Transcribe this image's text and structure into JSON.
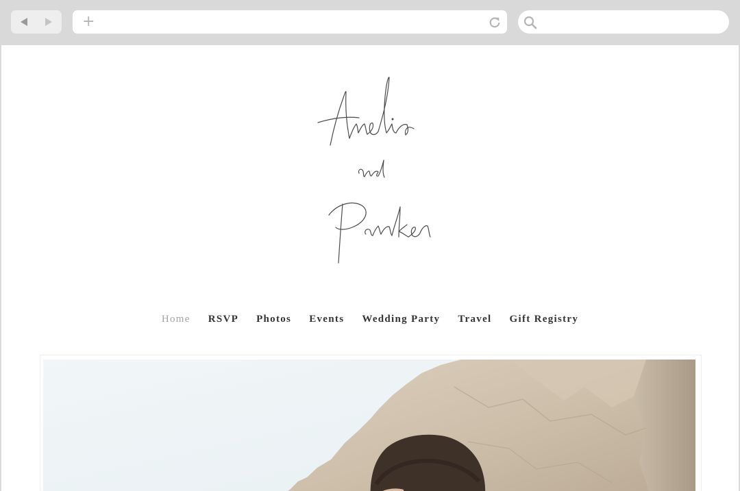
{
  "browser": {
    "back_icon": "back-arrow-icon",
    "forward_icon": "forward-arrow-icon",
    "new_tab_symbol": "+",
    "reload_icon": "reload-icon",
    "search_icon": "search-icon"
  },
  "site": {
    "name_first": "Amelia",
    "name_join": "and",
    "name_second": "Parker"
  },
  "nav": {
    "items": [
      {
        "label": "Home",
        "active": true
      },
      {
        "label": "RSVP"
      },
      {
        "label": "Photos"
      },
      {
        "label": "Events"
      },
      {
        "label": "Wedding Party"
      },
      {
        "label": "Travel"
      },
      {
        "label": "Gift Registry"
      }
    ]
  },
  "colors": {
    "chrome": "#d9d9d9",
    "nav_text": "#333333",
    "nav_active": "#a3a3a3",
    "script_ink": "#4a4a4a"
  }
}
